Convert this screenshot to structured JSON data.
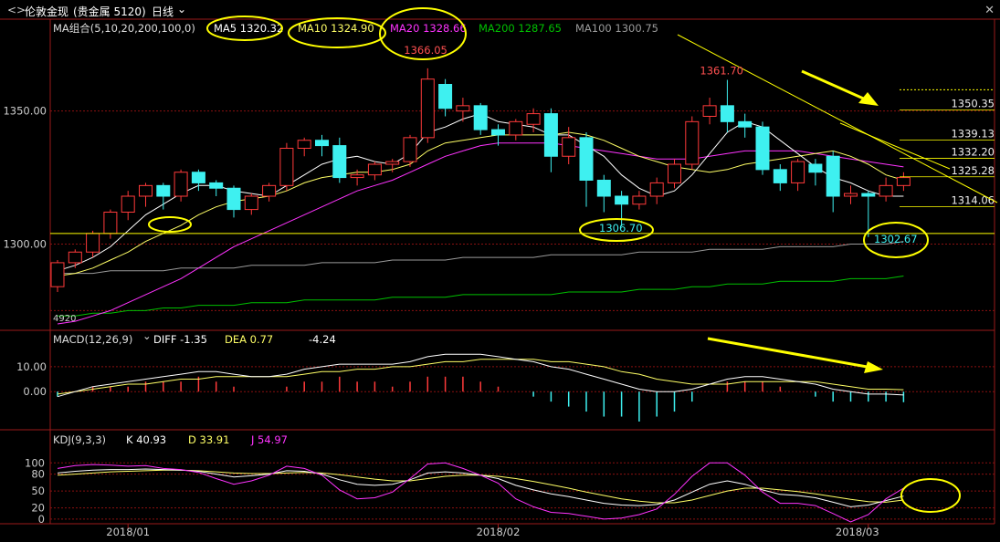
{
  "header": {
    "nav_icon": "double-arrow-icon",
    "instrument": "伦敦金现",
    "market": "(贵金属 5120)",
    "period": "日线",
    "period_dropdown_icon": "chevron-down-icon",
    "close_icon": "close-icon",
    "close_glyph": "✕"
  },
  "colors": {
    "up": "#ff3a3a",
    "down": "#3ef0f0",
    "ma5": "#ffffff",
    "ma10": "#ffff66",
    "ma20": "#ff33ff",
    "ma200": "#00c000",
    "ma100": "#9a9a9a",
    "grid": "#8a1010",
    "annotation": "#ffff00",
    "price_label": "#ff5050",
    "low_label": "#3ef0f0"
  },
  "chart_data": [
    {
      "type": "candlestick",
      "title": "MA组合(5,10,20,200,100,0)",
      "legend": [
        {
          "name": "MA5",
          "value": "1320.32"
        },
        {
          "name": "MA10",
          "value": "1324.90"
        },
        {
          "name": "MA20",
          "value": "1328.66"
        },
        {
          "name": "MA200",
          "value": "1287.65"
        },
        {
          "name": "MA100",
          "value": "1300.75"
        }
      ],
      "y_ticks": [
        "1350.00",
        "1300.00"
      ],
      "ylim": [
        1270,
        1378
      ],
      "x_ticks": [
        {
          "label": "2018/01",
          "index": 4
        },
        {
          "label": "2018/02",
          "index": 25
        },
        {
          "label": "2018/03",
          "index": 46
        }
      ],
      "candles": [
        [
          1284,
          1293,
          1282,
          1294
        ],
        [
          1293,
          1297,
          1291,
          1298
        ],
        [
          1297,
          1304,
          1295,
          1305
        ],
        [
          1304,
          1312,
          1302,
          1313
        ],
        [
          1312,
          1318,
          1309,
          1320
        ],
        [
          1318,
          1322,
          1314,
          1323
        ],
        [
          1322,
          1318,
          1313,
          1323
        ],
        [
          1318,
          1327,
          1316,
          1328
        ],
        [
          1327,
          1323,
          1320,
          1328
        ],
        [
          1323,
          1321,
          1318,
          1324
        ],
        [
          1321,
          1313,
          1310,
          1322
        ],
        [
          1313,
          1318,
          1311,
          1319
        ],
        [
          1318,
          1322,
          1316,
          1323
        ],
        [
          1322,
          1336,
          1320,
          1338
        ],
        [
          1336,
          1339,
          1333,
          1340
        ],
        [
          1339,
          1337,
          1333,
          1341
        ],
        [
          1337,
          1325,
          1323,
          1340
        ],
        [
          1325,
          1326,
          1322,
          1328
        ],
        [
          1326,
          1330,
          1324,
          1331
        ],
        [
          1330,
          1331,
          1327,
          1332
        ],
        [
          1331,
          1340,
          1329,
          1341
        ],
        [
          1340,
          1362,
          1338,
          1366.05
        ],
        [
          1360,
          1351,
          1348,
          1362
        ],
        [
          1350,
          1352,
          1346,
          1355
        ],
        [
          1352,
          1343,
          1341,
          1353
        ],
        [
          1343,
          1341,
          1337,
          1345
        ],
        [
          1341,
          1346,
          1339,
          1347
        ],
        [
          1345,
          1349,
          1342,
          1351
        ],
        [
          1349,
          1333,
          1327,
          1351
        ],
        [
          1333,
          1340,
          1330,
          1344
        ],
        [
          1340,
          1324,
          1314,
          1342
        ],
        [
          1324,
          1318,
          1312,
          1326
        ],
        [
          1318,
          1315,
          1306.7,
          1320
        ],
        [
          1315,
          1318,
          1313,
          1320
        ],
        [
          1318,
          1323,
          1315,
          1325
        ],
        [
          1323,
          1330,
          1321,
          1332
        ],
        [
          1330,
          1346,
          1328,
          1348
        ],
        [
          1348,
          1352,
          1345,
          1355
        ],
        [
          1352,
          1346,
          1342,
          1361.7
        ],
        [
          1346,
          1344,
          1340,
          1349
        ],
        [
          1344,
          1328,
          1326,
          1346
        ],
        [
          1328,
          1323,
          1320,
          1330
        ],
        [
          1323,
          1331,
          1320,
          1332
        ],
        [
          1330,
          1327,
          1322,
          1332
        ],
        [
          1333,
          1318,
          1312,
          1335
        ],
        [
          1318,
          1319,
          1315,
          1322
        ],
        [
          1319,
          1318,
          1302.67,
          1320
        ],
        [
          1318,
          1322,
          1316,
          1325
        ],
        [
          1322,
          1325,
          1320,
          1327
        ]
      ],
      "ma5": [
        1290,
        1292,
        1295,
        1299,
        1305,
        1311,
        1315,
        1319,
        1322,
        1322,
        1320,
        1319,
        1318,
        1322,
        1326,
        1330,
        1332,
        1333,
        1331,
        1330,
        1334,
        1342,
        1344,
        1347,
        1349,
        1346,
        1345,
        1344,
        1341,
        1341,
        1337,
        1333,
        1326,
        1321,
        1318,
        1320,
        1326,
        1334,
        1342,
        1346,
        1344,
        1339,
        1334,
        1329,
        1325,
        1323,
        1320,
        1318,
        1318
      ],
      "ma10": [
        1288,
        1289,
        1291,
        1294,
        1297,
        1301,
        1304,
        1307,
        1311,
        1314,
        1316,
        1317,
        1318,
        1320,
        1323,
        1325,
        1326,
        1327,
        1327,
        1328,
        1330,
        1335,
        1338,
        1339,
        1340,
        1341,
        1341,
        1341,
        1341,
        1342,
        1341,
        1339,
        1336,
        1333,
        1331,
        1329,
        1328,
        1327,
        1328,
        1330,
        1331,
        1332,
        1333,
        1334,
        1335,
        1333,
        1330,
        1326,
        1324
      ],
      "ma20": [
        1270,
        1271,
        1273,
        1275,
        1278,
        1281,
        1284,
        1287,
        1291,
        1295,
        1299,
        1302,
        1305,
        1308,
        1311,
        1314,
        1317,
        1320,
        1322,
        1324,
        1327,
        1330,
        1333,
        1335,
        1337,
        1338,
        1338,
        1338,
        1338,
        1337,
        1336,
        1335,
        1334,
        1333,
        1332,
        1332,
        1332,
        1333,
        1334,
        1335,
        1335,
        1335,
        1335,
        1334,
        1333,
        1332,
        1331,
        1330,
        1329
      ],
      "ma100": [
        1289,
        1289,
        1289,
        1290,
        1290,
        1290,
        1290,
        1291,
        1291,
        1291,
        1291,
        1292,
        1292,
        1292,
        1292,
        1293,
        1293,
        1293,
        1293,
        1294,
        1294,
        1294,
        1294,
        1295,
        1295,
        1295,
        1295,
        1295,
        1296,
        1296,
        1296,
        1296,
        1296,
        1297,
        1297,
        1297,
        1297,
        1298,
        1298,
        1298,
        1298,
        1299,
        1299,
        1299,
        1299,
        1300,
        1300,
        1300,
        1301
      ],
      "ma200": [
        1273,
        1273,
        1274,
        1274,
        1275,
        1275,
        1276,
        1276,
        1277,
        1277,
        1277,
        1278,
        1278,
        1278,
        1279,
        1279,
        1279,
        1279,
        1279,
        1280,
        1280,
        1280,
        1280,
        1281,
        1281,
        1281,
        1281,
        1281,
        1281,
        1282,
        1282,
        1282,
        1282,
        1283,
        1283,
        1283,
        1284,
        1284,
        1285,
        1285,
        1285,
        1286,
        1286,
        1286,
        1286,
        1287,
        1287,
        1287,
        1288
      ],
      "annotations": {
        "high_label": "1366.05",
        "peak2_label": "1361.70",
        "low1_label": "1306.70",
        "low2_label": "1302.67",
        "support_level": 1304,
        "corner_label": "4920",
        "levels": [
          {
            "label": "1350.35",
            "value": 1350.35
          },
          {
            "label": "1339.13",
            "value": 1339.13
          },
          {
            "label": "1332.20",
            "value": 1332.2
          },
          {
            "label": "1325.28",
            "value": 1325.28
          },
          {
            "label": "1314.06",
            "value": 1314.06
          }
        ]
      }
    },
    {
      "type": "macd",
      "title": "MACD(12,26,9)",
      "legend": [
        {
          "name": "DIFF",
          "value": "-1.35"
        },
        {
          "name": "DEA",
          "value": "0.77"
        },
        {
          "name": "MACD",
          "value": "-4.24"
        }
      ],
      "y_ticks": [
        "10.00",
        "0.00"
      ],
      "ylim": [
        -12,
        18
      ],
      "diff": [
        -2,
        0,
        2,
        3,
        4,
        5,
        6,
        7,
        8,
        8,
        7,
        6,
        6,
        7,
        9,
        10,
        11,
        11,
        11,
        11,
        12,
        14,
        15,
        15,
        15,
        14,
        13,
        12,
        10,
        9,
        7,
        5,
        3,
        1,
        0,
        0,
        1,
        3,
        5,
        6,
        6,
        5,
        4,
        3,
        1,
        0,
        -1,
        -1,
        -1.35
      ],
      "dea": [
        -1,
        0,
        1,
        2,
        3,
        3,
        4,
        5,
        5,
        6,
        6,
        6,
        6,
        6,
        7,
        8,
        8,
        9,
        9,
        10,
        10,
        11,
        12,
        12,
        13,
        13,
        13,
        13,
        12,
        12,
        11,
        10,
        8,
        7,
        5,
        4,
        3,
        3,
        3,
        4,
        4,
        4,
        4,
        4,
        3,
        2,
        1,
        1,
        0.77
      ],
      "hist": [
        -2,
        0,
        2,
        2,
        2,
        4,
        4,
        4,
        6,
        4,
        2,
        0,
        0,
        2,
        4,
        4,
        6,
        4,
        4,
        2,
        4,
        6,
        6,
        6,
        4,
        2,
        0,
        -2,
        -4,
        -6,
        -8,
        -10,
        -10,
        -12,
        -10,
        -8,
        -4,
        0,
        4,
        4,
        4,
        2,
        0,
        -2,
        -4,
        -4,
        -4,
        -4,
        -4.24
      ]
    },
    {
      "type": "kdj",
      "title": "KDJ(9,3,3)",
      "legend": [
        {
          "name": "K",
          "value": "40.93"
        },
        {
          "name": "D",
          "value": "33.91"
        },
        {
          "name": "J",
          "value": "54.97"
        }
      ],
      "y_ticks": [
        "100",
        "80",
        "50",
        "20",
        "0"
      ],
      "ylim": [
        -5,
        115
      ],
      "k": [
        82,
        85,
        87,
        88,
        88,
        89,
        88,
        87,
        85,
        80,
        75,
        77,
        80,
        86,
        85,
        80,
        70,
        62,
        60,
        62,
        70,
        82,
        84,
        82,
        78,
        72,
        60,
        52,
        45,
        40,
        34,
        28,
        25,
        24,
        26,
        34,
        48,
        62,
        68,
        62,
        52,
        44,
        42,
        38,
        30,
        22,
        25,
        33,
        40.93
      ],
      "d": [
        78,
        80,
        82,
        84,
        85,
        86,
        87,
        87,
        86,
        84,
        82,
        81,
        81,
        82,
        83,
        82,
        79,
        75,
        71,
        68,
        68,
        72,
        76,
        78,
        78,
        76,
        72,
        67,
        61,
        55,
        48,
        42,
        36,
        32,
        29,
        29,
        34,
        42,
        50,
        55,
        55,
        52,
        49,
        45,
        40,
        35,
        31,
        30,
        33.91
      ],
      "j": [
        90,
        95,
        97,
        96,
        94,
        95,
        90,
        88,
        83,
        72,
        62,
        68,
        78,
        94,
        90,
        78,
        52,
        36,
        38,
        48,
        72,
        98,
        100,
        90,
        78,
        64,
        36,
        22,
        12,
        10,
        5,
        0,
        2,
        8,
        18,
        44,
        76,
        100,
        100,
        78,
        48,
        28,
        28,
        24,
        10,
        -5,
        8,
        36,
        54.97
      ]
    }
  ],
  "x_axis_labels": [
    "2018/01",
    "2018/02",
    "2018/03"
  ]
}
